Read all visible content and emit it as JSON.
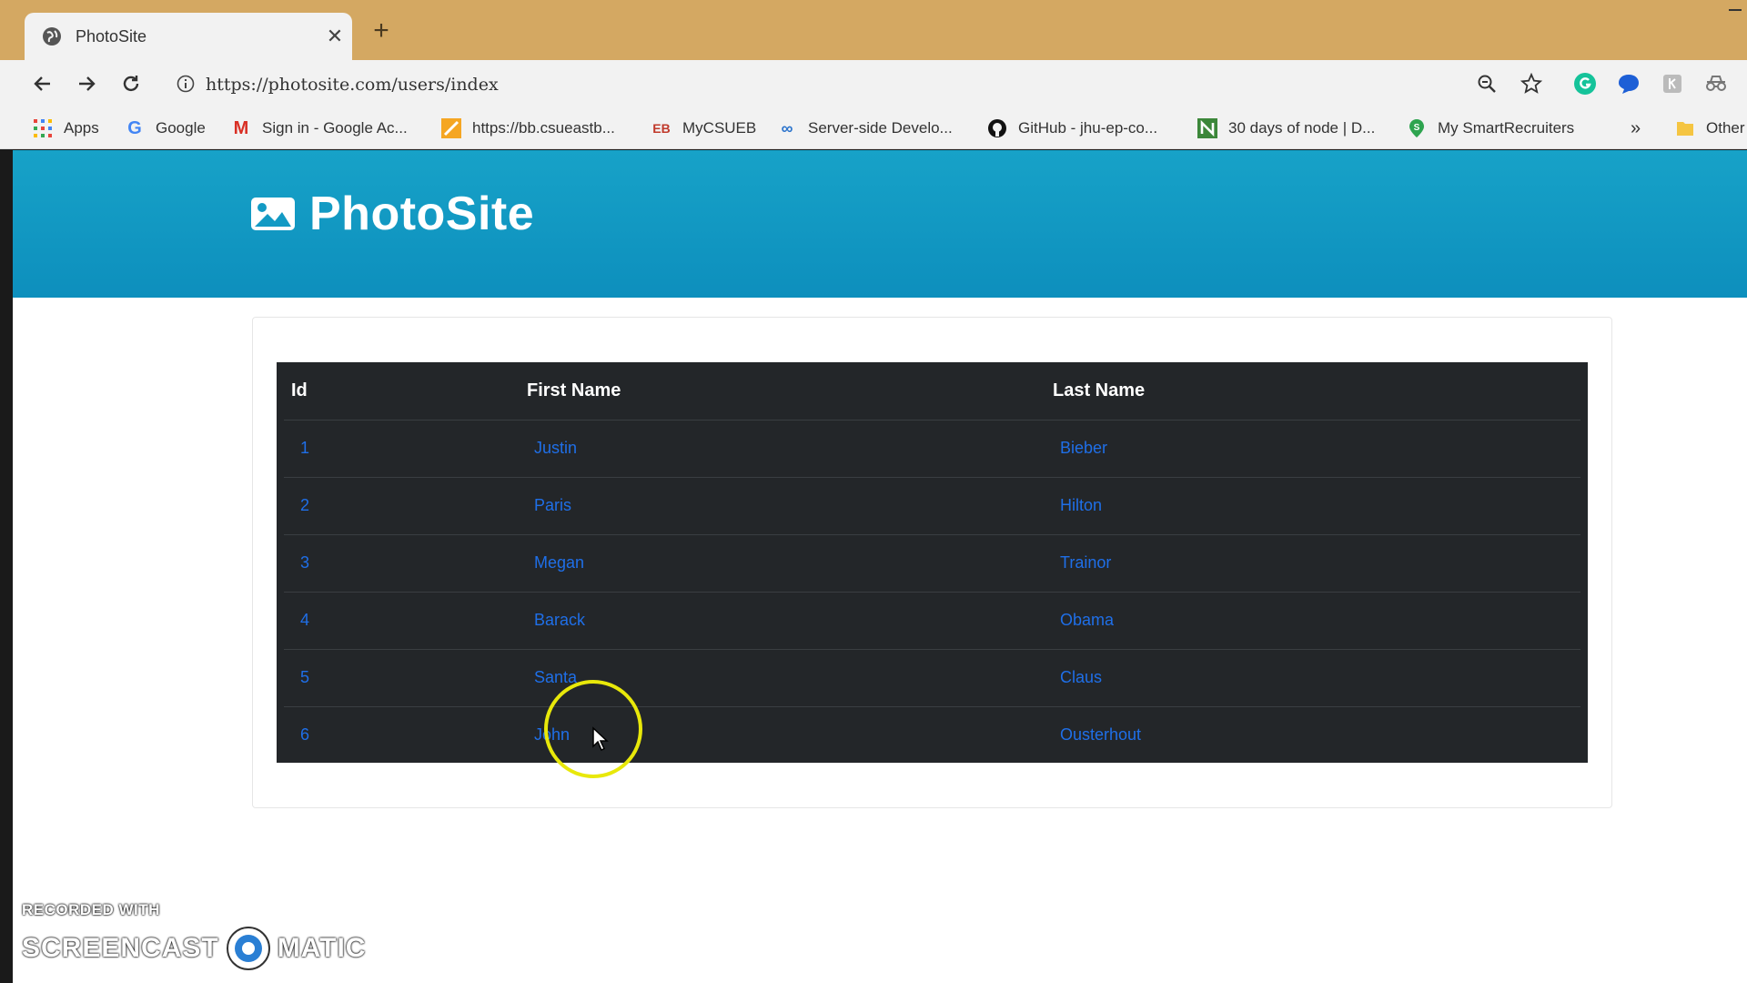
{
  "browser": {
    "tab_title": "PhotoSite",
    "url": "https://photosite.com/users/index",
    "bookmarks": [
      {
        "label": "Apps",
        "icon": "apps-grid-icon"
      },
      {
        "label": "Google",
        "icon": "google-icon"
      },
      {
        "label": "Sign in - Google Ac...",
        "icon": "gmail-icon"
      },
      {
        "label": "https://bb.csueastb...",
        "icon": "blackboard-icon"
      },
      {
        "label": "MyCSUEB",
        "icon": "eb-icon"
      },
      {
        "label": "Server-side Develo...",
        "icon": "coursera-icon"
      },
      {
        "label": "GitHub - jhu-ep-co...",
        "icon": "github-icon"
      },
      {
        "label": "30 days of node | D...",
        "icon": "n-icon"
      },
      {
        "label": "My SmartRecruiters",
        "icon": "smartrecruiters-icon"
      }
    ],
    "overflow_label": "»",
    "other_bookmarks": "Other"
  },
  "site": {
    "brand": "PhotoSite"
  },
  "table": {
    "headers": [
      "Id",
      "First Name",
      "Last Name"
    ],
    "rows": [
      {
        "id": "1",
        "first": "Justin",
        "last": "Bieber"
      },
      {
        "id": "2",
        "first": "Paris",
        "last": "Hilton"
      },
      {
        "id": "3",
        "first": "Megan",
        "last": "Trainor"
      },
      {
        "id": "4",
        "first": "Barack",
        "last": "Obama"
      },
      {
        "id": "5",
        "first": "Santa",
        "last": "Claus"
      },
      {
        "id": "6",
        "first": "John",
        "last": "Ousterhout"
      }
    ]
  },
  "watermark": {
    "line1": "RECORDED WITH",
    "left": "SCREENCAST",
    "right": "MATIC"
  },
  "colors": {
    "navbar": "#17a2c8",
    "table_bg": "#232629",
    "link": "#1f6fe8",
    "titlebar": "#d4a862"
  }
}
